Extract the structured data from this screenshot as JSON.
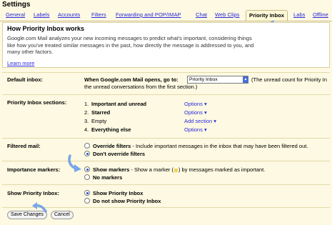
{
  "page": {
    "title": "Settings"
  },
  "tabs": [
    {
      "label": "General"
    },
    {
      "label": "Labels"
    },
    {
      "label": "Accounts"
    },
    {
      "label": "Filters"
    },
    {
      "label": "Forwarding and POP/IMAP"
    },
    {
      "label": "Chat"
    },
    {
      "label": "Web Clips"
    },
    {
      "label": "Priority Inbox",
      "active": true
    },
    {
      "label": "Labs"
    },
    {
      "label": "Offline"
    }
  ],
  "intro": {
    "title": "How Priority Inbox works",
    "text": "Google.com Mail analyzes your new incoming messages to predict what's important, considering things like how you've treated similar messages in the past, how directly the message is addressed to you, and many other factors.",
    "learn_more": "Learn more"
  },
  "default_inbox": {
    "label": "Default inbox:",
    "prompt": "When Google.com Mail opens, go to:",
    "selected": "Priority Inbox",
    "note_line1": "(The unread count for Priority In",
    "note_line2": "the unread conversations from the first section.)"
  },
  "sections": {
    "label": "Priority Inbox sections:",
    "items": [
      {
        "num": "1.",
        "name": "Important and unread",
        "bold": true,
        "action": "Options"
      },
      {
        "num": "2.",
        "name": "Starred",
        "bold": true,
        "action": "Options"
      },
      {
        "num": "3.",
        "name": "Empty",
        "bold": false,
        "action": "Add section"
      },
      {
        "num": "4.",
        "name": "Everything else",
        "bold": true,
        "action": "Options"
      }
    ]
  },
  "filtered_mail": {
    "label": "Filtered mail:",
    "option1_bold": "Override filters",
    "option1_rest": " - Include important messages in the inbox that may have been filtered out.",
    "option2": "Don't override filters",
    "selected": 2
  },
  "importance_markers": {
    "label": "Importance markers:",
    "option1_bold": "Show markers",
    "option1_pre": " - Show a marker (",
    "option1_post": ") by messages marked as important.",
    "option2": "No markers",
    "selected": 1
  },
  "show_priority": {
    "label": "Show Priority Inbox:",
    "option1": "Show Priority Inbox",
    "option2": "Do not show Priority Inbox",
    "selected": 1
  },
  "buttons": {
    "save": "Save Changes",
    "cancel": "Cancel"
  },
  "colors": {
    "link": "#2a2adc",
    "background": "#fdf9e2",
    "arrow": "#7aa6e6"
  }
}
